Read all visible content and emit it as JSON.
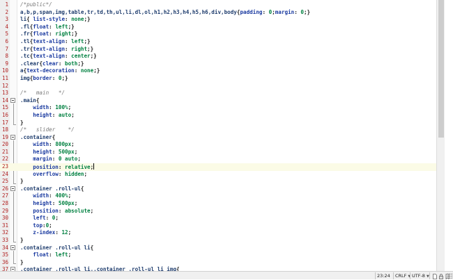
{
  "editor": {
    "current_line": 23,
    "lines": [
      {
        "n": "1",
        "tokens": [
          [
            "comment",
            "/*public*/"
          ]
        ]
      },
      {
        "n": "2",
        "tokens": [
          [
            "sel",
            "a,b,p,span,img,table,tr,td,th,ul,li,dl,ol,h1,h2,h3,h4,h5,h6,div,body"
          ],
          [
            "punc",
            "{"
          ],
          [
            "prop",
            "padding"
          ],
          [
            "punc",
            ": "
          ],
          [
            "val",
            "0"
          ],
          [
            "punc",
            ";"
          ],
          [
            "prop",
            "margin"
          ],
          [
            "punc",
            ": "
          ],
          [
            "val",
            "0"
          ],
          [
            "punc",
            ";}"
          ]
        ]
      },
      {
        "n": "3",
        "tokens": [
          [
            "sel",
            "li"
          ],
          [
            "punc",
            "{ "
          ],
          [
            "prop",
            "list-style"
          ],
          [
            "punc",
            ": "
          ],
          [
            "val",
            "none"
          ],
          [
            "punc",
            ";}"
          ]
        ]
      },
      {
        "n": "4",
        "tokens": [
          [
            "sel",
            ".fl"
          ],
          [
            "punc",
            "{"
          ],
          [
            "prop",
            "float"
          ],
          [
            "punc",
            ": "
          ],
          [
            "val",
            "left"
          ],
          [
            "punc",
            ";}"
          ]
        ]
      },
      {
        "n": "5",
        "tokens": [
          [
            "sel",
            ".fr"
          ],
          [
            "punc",
            "{"
          ],
          [
            "prop",
            "float"
          ],
          [
            "punc",
            ": "
          ],
          [
            "val",
            "right"
          ],
          [
            "punc",
            ";}"
          ]
        ]
      },
      {
        "n": "6",
        "tokens": [
          [
            "sel",
            ".tl"
          ],
          [
            "punc",
            "{"
          ],
          [
            "prop",
            "text-align"
          ],
          [
            "punc",
            ": "
          ],
          [
            "val",
            "left"
          ],
          [
            "punc",
            ";}"
          ]
        ]
      },
      {
        "n": "7",
        "tokens": [
          [
            "sel",
            ".tr"
          ],
          [
            "punc",
            "{"
          ],
          [
            "prop",
            "text-align"
          ],
          [
            "punc",
            ": "
          ],
          [
            "val",
            "right"
          ],
          [
            "punc",
            ";}"
          ]
        ]
      },
      {
        "n": "8",
        "tokens": [
          [
            "sel",
            ".tc"
          ],
          [
            "punc",
            "{"
          ],
          [
            "prop",
            "text-align"
          ],
          [
            "punc",
            ": "
          ],
          [
            "val",
            "center"
          ],
          [
            "punc",
            ";}"
          ]
        ]
      },
      {
        "n": "9",
        "tokens": [
          [
            "sel",
            ".clear"
          ],
          [
            "punc",
            "{"
          ],
          [
            "prop",
            "clear"
          ],
          [
            "punc",
            ": "
          ],
          [
            "val",
            "both"
          ],
          [
            "punc",
            ";}"
          ]
        ]
      },
      {
        "n": "10",
        "tokens": [
          [
            "sel",
            "a"
          ],
          [
            "punc",
            "{"
          ],
          [
            "prop",
            "text-decoration"
          ],
          [
            "punc",
            ": "
          ],
          [
            "val",
            "none"
          ],
          [
            "punc",
            ";}"
          ]
        ]
      },
      {
        "n": "11",
        "tokens": [
          [
            "sel",
            "img"
          ],
          [
            "punc",
            "{"
          ],
          [
            "prop",
            "border"
          ],
          [
            "punc",
            ": "
          ],
          [
            "val",
            "0"
          ],
          [
            "punc",
            ";}"
          ]
        ]
      },
      {
        "n": "12",
        "tokens": []
      },
      {
        "n": "13",
        "tokens": [
          [
            "comment",
            "/*   main   */"
          ]
        ]
      },
      {
        "n": "14",
        "tokens": [
          [
            "sel",
            ".main"
          ],
          [
            "punc",
            "{"
          ]
        ]
      },
      {
        "n": "15",
        "tokens": [
          [
            "punc",
            "    "
          ],
          [
            "prop",
            "width"
          ],
          [
            "punc",
            ": "
          ],
          [
            "val",
            "100%"
          ],
          [
            "punc",
            ";"
          ]
        ]
      },
      {
        "n": "16",
        "tokens": [
          [
            "punc",
            "    "
          ],
          [
            "prop",
            "height"
          ],
          [
            "punc",
            ": "
          ],
          [
            "val",
            "auto"
          ],
          [
            "punc",
            ";"
          ]
        ]
      },
      {
        "n": "17",
        "tokens": [
          [
            "punc",
            "}"
          ]
        ]
      },
      {
        "n": "18",
        "tokens": [
          [
            "comment",
            "/*   slider    */"
          ]
        ]
      },
      {
        "n": "19",
        "tokens": [
          [
            "sel",
            ".container"
          ],
          [
            "punc",
            "{"
          ]
        ]
      },
      {
        "n": "20",
        "tokens": [
          [
            "punc",
            "    "
          ],
          [
            "prop",
            "width"
          ],
          [
            "punc",
            ": "
          ],
          [
            "val",
            "800px"
          ],
          [
            "punc",
            ";"
          ]
        ]
      },
      {
        "n": "21",
        "tokens": [
          [
            "punc",
            "    "
          ],
          [
            "prop",
            "height"
          ],
          [
            "punc",
            ": "
          ],
          [
            "val",
            "500px"
          ],
          [
            "punc",
            ";"
          ]
        ]
      },
      {
        "n": "22",
        "tokens": [
          [
            "punc",
            "    "
          ],
          [
            "prop",
            "margin"
          ],
          [
            "punc",
            ": "
          ],
          [
            "val",
            "0 auto"
          ],
          [
            "punc",
            ";"
          ]
        ]
      },
      {
        "n": "23",
        "tokens": [
          [
            "punc",
            "    "
          ],
          [
            "prop",
            "position"
          ],
          [
            "punc",
            ": "
          ],
          [
            "val",
            "relative"
          ],
          [
            "punc",
            ";"
          ]
        ]
      },
      {
        "n": "24",
        "tokens": [
          [
            "punc",
            "    "
          ],
          [
            "prop",
            "overflow"
          ],
          [
            "punc",
            ": "
          ],
          [
            "val",
            "hidden"
          ],
          [
            "punc",
            ";"
          ]
        ]
      },
      {
        "n": "25",
        "tokens": [
          [
            "punc",
            "}"
          ]
        ]
      },
      {
        "n": "26",
        "tokens": [
          [
            "sel",
            ".container .roll-ul"
          ],
          [
            "punc",
            "{"
          ]
        ]
      },
      {
        "n": "27",
        "tokens": [
          [
            "punc",
            "    "
          ],
          [
            "prop",
            "width"
          ],
          [
            "punc",
            ": "
          ],
          [
            "val",
            "400%"
          ],
          [
            "punc",
            ";"
          ]
        ]
      },
      {
        "n": "28",
        "tokens": [
          [
            "punc",
            "    "
          ],
          [
            "prop",
            "height"
          ],
          [
            "punc",
            ": "
          ],
          [
            "val",
            "500px"
          ],
          [
            "punc",
            ";"
          ]
        ]
      },
      {
        "n": "29",
        "tokens": [
          [
            "punc",
            "    "
          ],
          [
            "prop",
            "position"
          ],
          [
            "punc",
            ": "
          ],
          [
            "val",
            "absolute"
          ],
          [
            "punc",
            ";"
          ]
        ]
      },
      {
        "n": "30",
        "tokens": [
          [
            "punc",
            "    "
          ],
          [
            "prop",
            "left"
          ],
          [
            "punc",
            ": "
          ],
          [
            "val",
            "0"
          ],
          [
            "punc",
            ";"
          ]
        ]
      },
      {
        "n": "31",
        "tokens": [
          [
            "punc",
            "    "
          ],
          [
            "prop",
            "top"
          ],
          [
            "punc",
            ":"
          ],
          [
            "val",
            "0"
          ],
          [
            "punc",
            ";"
          ]
        ]
      },
      {
        "n": "32",
        "tokens": [
          [
            "punc",
            "    "
          ],
          [
            "prop",
            "z-index"
          ],
          [
            "punc",
            ": "
          ],
          [
            "val",
            "12"
          ],
          [
            "punc",
            ";"
          ]
        ]
      },
      {
        "n": "33",
        "tokens": [
          [
            "punc",
            "}"
          ]
        ]
      },
      {
        "n": "34",
        "tokens": [
          [
            "sel",
            ".container .roll-ul li"
          ],
          [
            "punc",
            "{"
          ]
        ]
      },
      {
        "n": "35",
        "tokens": [
          [
            "punc",
            "    "
          ],
          [
            "prop",
            "float"
          ],
          [
            "punc",
            ": "
          ],
          [
            "val",
            "left"
          ],
          [
            "punc",
            ";"
          ]
        ]
      },
      {
        "n": "36",
        "tokens": [
          [
            "punc",
            "}"
          ]
        ]
      },
      {
        "n": "37",
        "tokens": [
          [
            "sel",
            ".container .roll-ul li,.container .roll-ul li img"
          ],
          [
            "punc",
            "{"
          ]
        ]
      }
    ]
  },
  "statusbar": {
    "cursor_position": "23:24",
    "line_ending": "CRLF",
    "encoding": "UTF-8"
  },
  "icons": {
    "fold": "fold-minus-icon",
    "status_icons": [
      "document-icon",
      "lock-icon",
      "bookmark-icon",
      "grip-icon"
    ]
  }
}
